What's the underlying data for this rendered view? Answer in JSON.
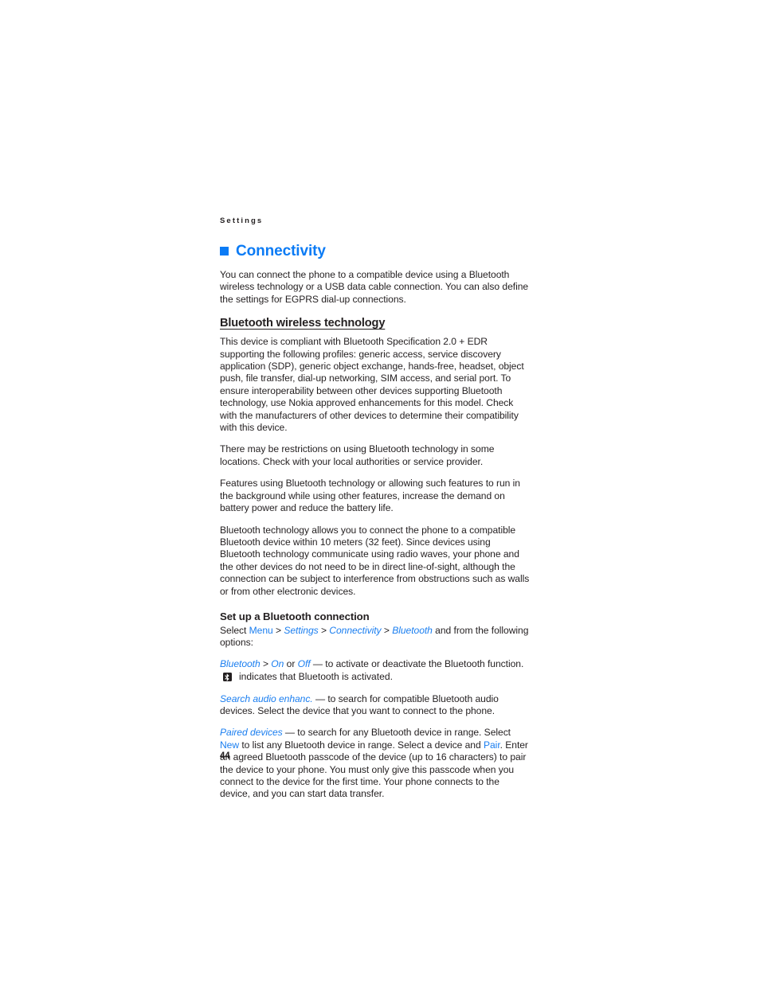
{
  "page": {
    "running_head": "Settings",
    "folio": "44",
    "accent_color": "#0b7bf5",
    "link_color": "#1a7ef0",
    "text_color": "#231f20"
  },
  "chapter": {
    "bullet_icon": "filled-square-icon",
    "title": "Connectivity",
    "intro": "You can connect the phone to a compatible device using a Bluetooth wireless technology or a USB data cable connection. You can also define the settings for EGPRS dial-up connections."
  },
  "bluetooth_section": {
    "heading": "Bluetooth wireless technology",
    "paragraphs": [
      "This device is compliant with Bluetooth Specification 2.0 + EDR supporting the following profiles: generic access, service discovery application (SDP), generic object exchange, hands-free, headset, object push, file transfer, dial-up networking, SIM access, and serial port. To ensure interoperability between other devices supporting Bluetooth technology, use Nokia approved enhancements for this model. Check with the manufacturers of other devices to determine their compatibility with this device.",
      "There may be restrictions on using Bluetooth technology in some locations. Check with your local authorities or service provider.",
      "Features using Bluetooth technology or allowing such features to run in the background while using other features, increase the demand on battery power and reduce the battery life.",
      "Bluetooth technology allows you to connect the phone to a compatible Bluetooth device within 10 meters (32 feet). Since devices using Bluetooth technology communicate using radio waves, your phone and the other devices do not need to be in direct line-of-sight, although the connection can be subject to interference from obstructions such as walls or from other electronic devices."
    ]
  },
  "setup_section": {
    "heading": "Set up a Bluetooth connection",
    "path_line": {
      "prefix": "Select ",
      "menu": "Menu",
      "sep1": " > ",
      "settings": "Settings",
      "sep2": " > ",
      "connectivity": "Connectivity",
      "sep3": " > ",
      "bluetooth": "Bluetooth",
      "suffix": " and from the following options:"
    },
    "bluetooth_option": {
      "label": "Bluetooth",
      "sep1": " > ",
      "on": "On",
      "or": " or ",
      "off": "Off",
      "description": " — to activate or deactivate the Bluetooth function."
    },
    "status_line": {
      "icon": "bluetooth-status-icon",
      "text": "indicates that Bluetooth is activated."
    },
    "search_audio_option": {
      "label": "Search audio enhanc.",
      "description": " — to search for compatible Bluetooth audio devices. Select the device that you want to connect to the phone."
    },
    "paired_devices_option": {
      "label": "Paired devices",
      "part1": " — to search for any Bluetooth device in range. Select ",
      "new": "New",
      "part2": " to list any Bluetooth device in range. Select a device and ",
      "pair": "Pair",
      "part3": ". Enter an agreed Bluetooth passcode of the device (up to 16 characters) to pair the device to your phone. You must only give this passcode when you connect to the device for the first time. Your phone connects to the device, and you can start data transfer."
    }
  }
}
